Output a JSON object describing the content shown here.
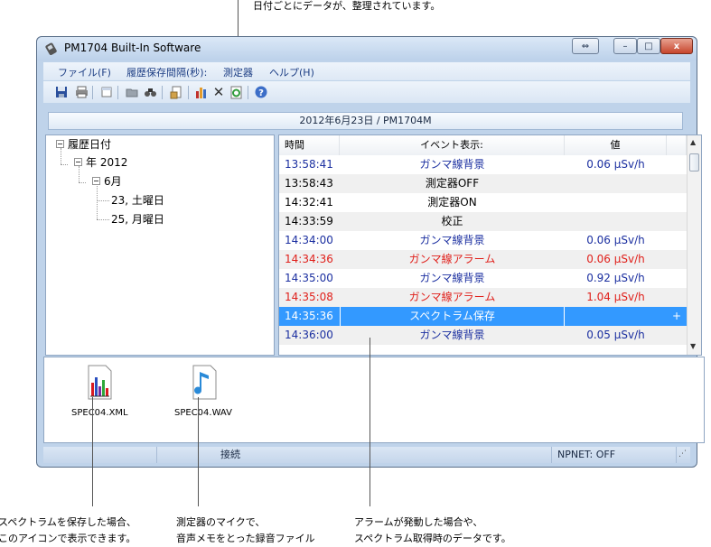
{
  "annotations": {
    "top": "日付ごとにデータが、整理されています。",
    "bottom_left": [
      "スペクトラムを保存した場合、",
      "このアイコンで表示できます。"
    ],
    "bottom_middle": [
      "測定器のマイクで、",
      "音声メモをとった録音ファイル"
    ],
    "bottom_right": [
      "アラームが発動した場合や、",
      "スペクトラム取得時のデータです。"
    ]
  },
  "window": {
    "title": "PM1704 Built-In Software",
    "controls": {
      "restore": "⇔",
      "minimize": "–",
      "maximize": "□",
      "close": "x"
    }
  },
  "menu": [
    "ファイル(F)",
    "履歴保存間隔(秒):",
    "測定器",
    "ヘルプ(H)"
  ],
  "toolbar_icons": [
    "save-icon",
    "print-icon",
    "new-icon",
    "open-folder-icon",
    "find-icon",
    "export-icon",
    "chart-icon",
    "delete-icon",
    "refresh-icon",
    "help-icon"
  ],
  "date_band": "2012年6月23日 / PM1704M",
  "tree": {
    "root": "履歴日付",
    "year": "年 2012",
    "month": "6月",
    "days": [
      "23, 土曜日",
      "25, 月曜日"
    ]
  },
  "table": {
    "headers": [
      "時間",
      "イベント表示:",
      "値"
    ],
    "rows": [
      {
        "time": "13:58:41",
        "event": "ガンマ線背景",
        "value": "0.06 µSv/h",
        "kind": "gamma"
      },
      {
        "time": "13:58:43",
        "event": "測定器OFF",
        "value": "",
        "kind": "plain"
      },
      {
        "time": "14:32:41",
        "event": "測定器ON",
        "value": "",
        "kind": "plain"
      },
      {
        "time": "14:33:59",
        "event": "校正",
        "value": "",
        "kind": "plain"
      },
      {
        "time": "14:34:00",
        "event": "ガンマ線背景",
        "value": "0.06 µSv/h",
        "kind": "gamma"
      },
      {
        "time": "14:34:36",
        "event": "ガンマ線アラーム",
        "value": "0.06 µSv/h",
        "kind": "alarm"
      },
      {
        "time": "14:35:00",
        "event": "ガンマ線背景",
        "value": "0.92 µSv/h",
        "kind": "gamma"
      },
      {
        "time": "14:35:08",
        "event": "ガンマ線アラーム",
        "value": "1.04 µSv/h",
        "kind": "alarm"
      },
      {
        "time": "14:35:36",
        "event": "スペクトラム保存",
        "value": "",
        "kind": "selected",
        "extra": "+"
      },
      {
        "time": "14:36:00",
        "event": "ガンマ線背景",
        "value": "0.05 µSv/h",
        "kind": "gamma"
      }
    ]
  },
  "files": [
    {
      "name": "SPEC04.XML",
      "icon": "spectrum-chart-icon"
    },
    {
      "name": "SPEC04.WAV",
      "icon": "audio-note-icon"
    }
  ],
  "status": {
    "connection": "接続",
    "npnet": "NPNET: OFF"
  },
  "colors": {
    "gamma": "#1b2fa0",
    "alarm": "#e0201b",
    "plain": "#000000",
    "selected_bg": "#3399ff",
    "alt_row": "#f0f0f0"
  }
}
